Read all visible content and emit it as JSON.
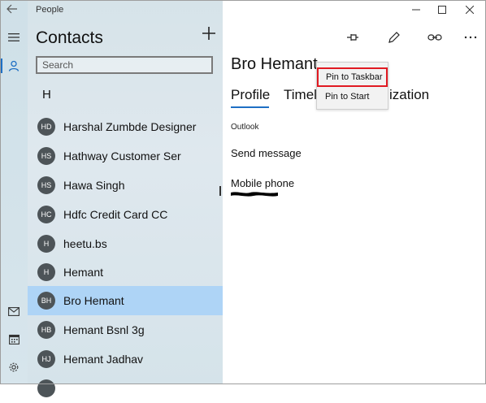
{
  "app": {
    "title": "People"
  },
  "sidebar": {
    "title": "Contacts",
    "search_placeholder": "Search",
    "group_letter": "H",
    "contacts": [
      {
        "initials": "HD",
        "name": "Harshal Zumbde Designer"
      },
      {
        "initials": "HS",
        "name": "Hathway Customer Ser"
      },
      {
        "initials": "HS",
        "name": "Hawa Singh"
      },
      {
        "initials": "HC",
        "name": "Hdfc Credit Card CC"
      },
      {
        "initials": "H",
        "name": "heetu.bs"
      },
      {
        "initials": "H",
        "name": "Hemant"
      },
      {
        "initials": "BH",
        "name": "Bro Hemant"
      },
      {
        "initials": "HB",
        "name": "Hemant Bsnl 3g"
      },
      {
        "initials": "HJ",
        "name": "Hemant Jadhav"
      }
    ],
    "selected_index": 6
  },
  "detail": {
    "name": "Bro Hemant",
    "tabs": [
      "Profile",
      "Timel",
      "ization"
    ],
    "section_label": "Outlook",
    "send_message": "Send message",
    "mobile_label": "Mobile phone"
  },
  "menu": {
    "items": [
      "Pin to Taskbar",
      "Pin to Start"
    ]
  },
  "colors": {
    "accent": "#1e6fc4",
    "selected_row": "#aed4f6",
    "highlight_outline": "#e11a22"
  }
}
